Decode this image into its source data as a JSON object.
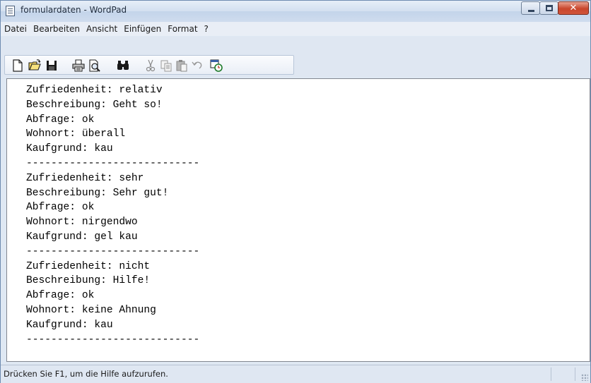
{
  "window": {
    "title": "formulardaten - WordPad"
  },
  "menu": [
    {
      "label": "Datei"
    },
    {
      "label": "Bearbeiten"
    },
    {
      "label": "Ansicht"
    },
    {
      "label": "Einfügen"
    },
    {
      "label": "Format"
    },
    {
      "label": "?"
    }
  ],
  "toolbar": [
    {
      "icon": "new-document-icon"
    },
    {
      "icon": "open-folder-icon"
    },
    {
      "icon": "save-icon"
    },
    {
      "icon": "print-icon"
    },
    {
      "icon": "print-preview-icon"
    },
    {
      "icon": "find-icon"
    },
    {
      "icon": "cut-icon"
    },
    {
      "icon": "copy-icon"
    },
    {
      "icon": "paste-icon"
    },
    {
      "icon": "undo-icon"
    },
    {
      "icon": "date-time-icon"
    }
  ],
  "document": {
    "lines": [
      "Zufriedenheit: relativ",
      "Beschreibung: Geht so!",
      "Abfrage: ok",
      "Wohnort: überall",
      "Kaufgrund: kau",
      "----------------------------",
      "Zufriedenheit: sehr",
      "Beschreibung: Sehr gut!",
      "Abfrage: ok",
      "Wohnort: nirgendwo",
      "Kaufgrund: gel kau",
      "----------------------------",
      "Zufriedenheit: nicht",
      "Beschreibung: Hilfe!",
      "Abfrage: ok",
      "Wohnort: keine Ahnung",
      "Kaufgrund: kau",
      "----------------------------"
    ]
  },
  "statusbar": {
    "text": "Drücken Sie F1, um die Hilfe aufzurufen."
  }
}
